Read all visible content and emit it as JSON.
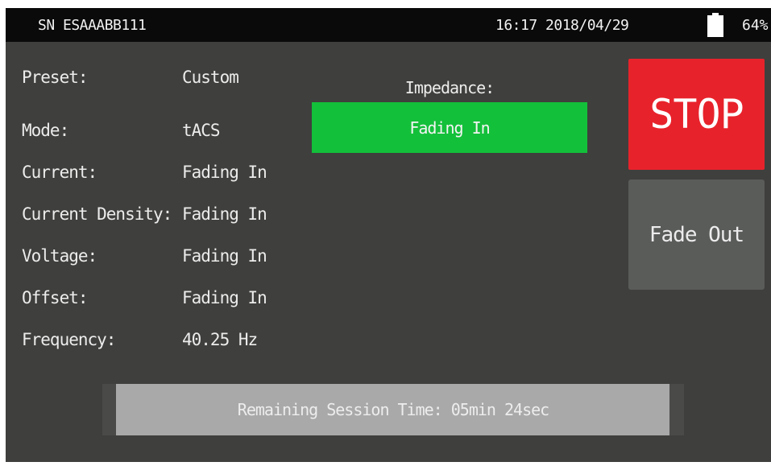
{
  "status_bar": {
    "serial": "SN ESAAABB111",
    "datetime": "16:17 2018/04/29",
    "battery_percent": "64%",
    "battery_icon": "battery-icon"
  },
  "parameters": [
    {
      "label": "Preset:",
      "value": "Custom"
    },
    {
      "label": "Mode:",
      "value": "tACS"
    },
    {
      "label": "Current:",
      "value": "Fading In"
    },
    {
      "label": "Current Density:",
      "value": "Fading In"
    },
    {
      "label": "Voltage:",
      "value": "Fading In"
    },
    {
      "label": "Offset:",
      "value": "Fading In"
    },
    {
      "label": "Frequency:",
      "value": "40.25 Hz"
    }
  ],
  "impedance": {
    "label": "Impedance:",
    "value": "Fading In",
    "color": "#13c03a"
  },
  "controls": {
    "stop_label": "STOP",
    "stop_color": "#e8222b",
    "fade_out_label": "Fade Out",
    "fade_out_color": "#5a5c5a"
  },
  "session": {
    "remaining_text": "Remaining Session Time: 05min 24sec",
    "progress_fraction": 0.975
  }
}
